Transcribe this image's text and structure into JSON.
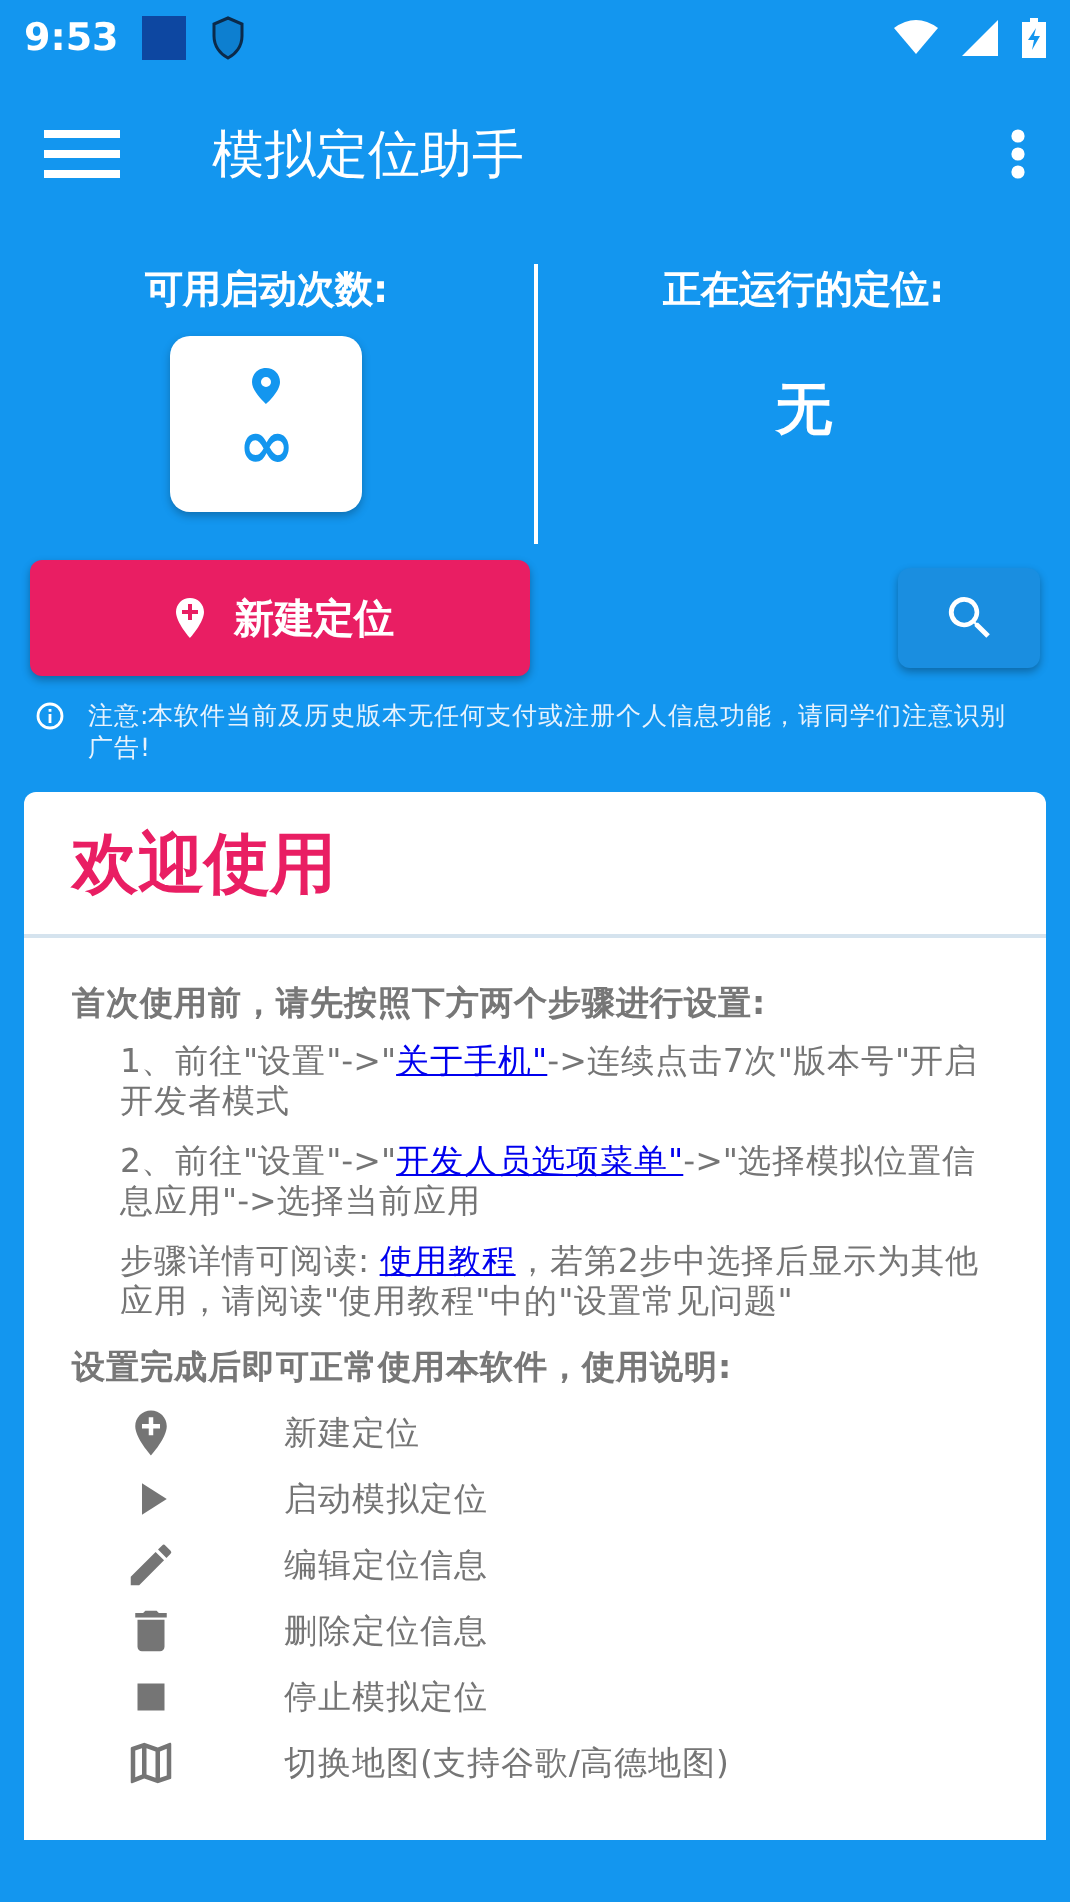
{
  "status_bar": {
    "time": "9:53"
  },
  "app_bar": {
    "title": "模拟定位助手"
  },
  "stats": [
    {
      "label": "可用启动次数:",
      "value": "∞",
      "kind": "counter"
    },
    {
      "label": "正在运行的定位:",
      "value": "无",
      "kind": "plain"
    }
  ],
  "new_button": {
    "label": "新建定位"
  },
  "notice": "注意:本软件当前及历史版本无任何支付或注册个人信息功能，请同学们注意识别广告!",
  "card": {
    "title": "欢迎使用",
    "intro_heading": "首次使用前，请先按照下方两个步骤进行设置:",
    "steps": [
      [
        {
          "kind": "text",
          "text": "1、前往\"设置\"->\""
        },
        {
          "kind": "link",
          "text": "关于手机\""
        },
        {
          "kind": "text",
          "text": "->连续点击7次\"版本号\"开启开发者模式"
        }
      ],
      [
        {
          "kind": "text",
          "text": "2、前往\"设置\"->\""
        },
        {
          "kind": "link",
          "text": "开发人员选项菜单\""
        },
        {
          "kind": "text",
          "text": "->\"选择模拟位置信息应用\"->选择当前应用"
        }
      ],
      [
        {
          "kind": "text",
          "text": "步骤详情可阅读: "
        },
        {
          "kind": "link",
          "text": "使用教程"
        },
        {
          "kind": "text",
          "text": "，若第2步中选择后显示为其他应用，请阅读\"使用教程\"中的\"设置常见问题\""
        }
      ]
    ],
    "usage_heading": "设置完成后即可正常使用本软件，使用说明:",
    "usage": [
      {
        "kind": "add-location",
        "text": "新建定位"
      },
      {
        "kind": "play",
        "text": "启动模拟定位"
      },
      {
        "kind": "edit",
        "text": "编辑定位信息"
      },
      {
        "kind": "delete",
        "text": "删除定位信息"
      },
      {
        "kind": "stop",
        "text": "停止模拟定位"
      },
      {
        "kind": "map",
        "text": "切换地图(支持谷歌/高德地图)"
      }
    ]
  }
}
